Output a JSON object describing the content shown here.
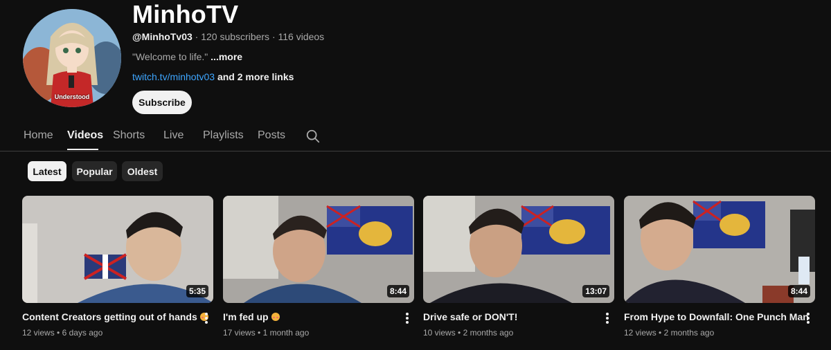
{
  "channel": {
    "name": "MinhoTV",
    "handle": "@MinhoTv03",
    "stats": " · 120 subscribers · 116 videos",
    "description": "\"Welcome to life.\"",
    "more_label": "...more",
    "link_text": "twitch.tv/minhotv03",
    "more_links": "and 2 more links",
    "subscribe_label": "Subscribe",
    "avatar_caption": "Understood"
  },
  "tabs": [
    {
      "label": "Home"
    },
    {
      "label": "Videos",
      "active": true
    },
    {
      "label": "Shorts"
    },
    {
      "label": "Live"
    },
    {
      "label": "Playlists"
    },
    {
      "label": "Posts"
    }
  ],
  "chips": [
    {
      "label": "Latest",
      "active": true
    },
    {
      "label": "Popular"
    },
    {
      "label": "Oldest"
    }
  ],
  "videos": [
    {
      "title": "Content Creators getting out of hands",
      "emoji": true,
      "duration": "5:35",
      "views": "12 views",
      "age": "6 days ago"
    },
    {
      "title": "I'm fed up",
      "emoji": true,
      "duration": "8:44",
      "views": "17 views",
      "age": "1 month ago"
    },
    {
      "title": "Drive safe or DON'T!",
      "emoji": false,
      "duration": "13:07",
      "views": "10 views",
      "age": "2 months ago"
    },
    {
      "title": "From Hype to Downfall: One Punch Man",
      "emoji": false,
      "duration": "8:44",
      "views": "12 views",
      "age": "2 months ago"
    }
  ],
  "colors": {
    "background": "#0f0f0f",
    "link": "#3ea6ff",
    "chip": "#272727",
    "text_secondary": "#aaaaaa"
  },
  "icons": {
    "search": "search-icon",
    "menu": "more-vert-icon"
  }
}
